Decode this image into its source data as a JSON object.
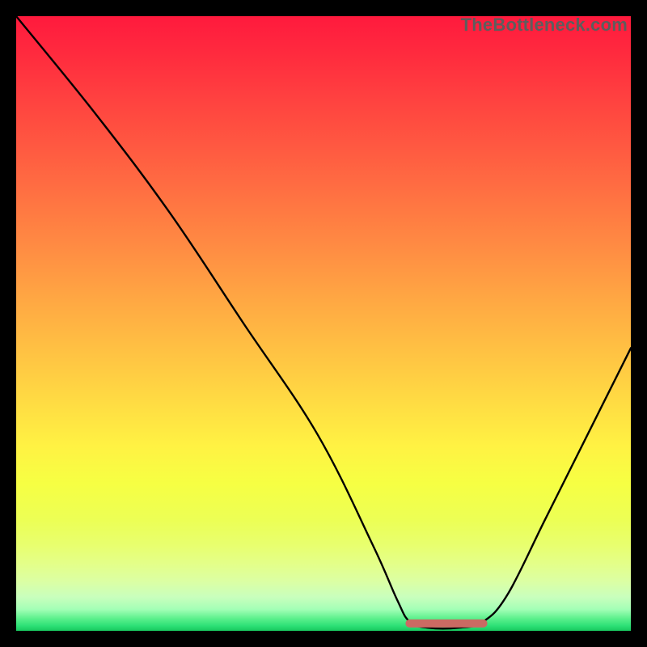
{
  "watermark": "TheBottleneck.com",
  "chart_data": {
    "type": "line",
    "title": "",
    "xlabel": "",
    "ylabel": "",
    "xlim": [
      0,
      100
    ],
    "ylim": [
      0,
      100
    ],
    "series": [
      {
        "name": "bottleneck-curve",
        "points": [
          {
            "x": 0,
            "y": 100
          },
          {
            "x": 13,
            "y": 84
          },
          {
            "x": 25,
            "y": 68
          },
          {
            "x": 37,
            "y": 50
          },
          {
            "x": 49,
            "y": 32
          },
          {
            "x": 58,
            "y": 14
          },
          {
            "x": 62,
            "y": 5
          },
          {
            "x": 64,
            "y": 1.5
          },
          {
            "x": 67,
            "y": 0.5
          },
          {
            "x": 72,
            "y": 0.5
          },
          {
            "x": 76,
            "y": 1.5
          },
          {
            "x": 80,
            "y": 6
          },
          {
            "x": 86,
            "y": 18
          },
          {
            "x": 93,
            "y": 32
          },
          {
            "x": 100,
            "y": 46
          }
        ]
      },
      {
        "name": "flat-bottom-marker",
        "points": [
          {
            "x": 64,
            "y": 1.2
          },
          {
            "x": 76,
            "y": 1.2
          }
        ]
      }
    ],
    "gradient_stops": [
      {
        "offset": 0.0,
        "color": "#ff1a3d"
      },
      {
        "offset": 0.06,
        "color": "#ff2a3e"
      },
      {
        "offset": 0.14,
        "color": "#ff4340"
      },
      {
        "offset": 0.22,
        "color": "#ff5b41"
      },
      {
        "offset": 0.3,
        "color": "#ff7442"
      },
      {
        "offset": 0.38,
        "color": "#ff8d43"
      },
      {
        "offset": 0.46,
        "color": "#ffa743"
      },
      {
        "offset": 0.54,
        "color": "#ffc043"
      },
      {
        "offset": 0.62,
        "color": "#ffd943"
      },
      {
        "offset": 0.7,
        "color": "#fff243"
      },
      {
        "offset": 0.76,
        "color": "#f6ff43"
      },
      {
        "offset": 0.82,
        "color": "#ecff55"
      },
      {
        "offset": 0.86,
        "color": "#e8ff6e"
      },
      {
        "offset": 0.89,
        "color": "#e4ff88"
      },
      {
        "offset": 0.92,
        "color": "#dbffa4"
      },
      {
        "offset": 0.945,
        "color": "#c9ffbd"
      },
      {
        "offset": 0.965,
        "color": "#a3ffb6"
      },
      {
        "offset": 0.98,
        "color": "#5cf08c"
      },
      {
        "offset": 0.992,
        "color": "#2de076"
      },
      {
        "offset": 1.0,
        "color": "#18c85f"
      }
    ]
  }
}
